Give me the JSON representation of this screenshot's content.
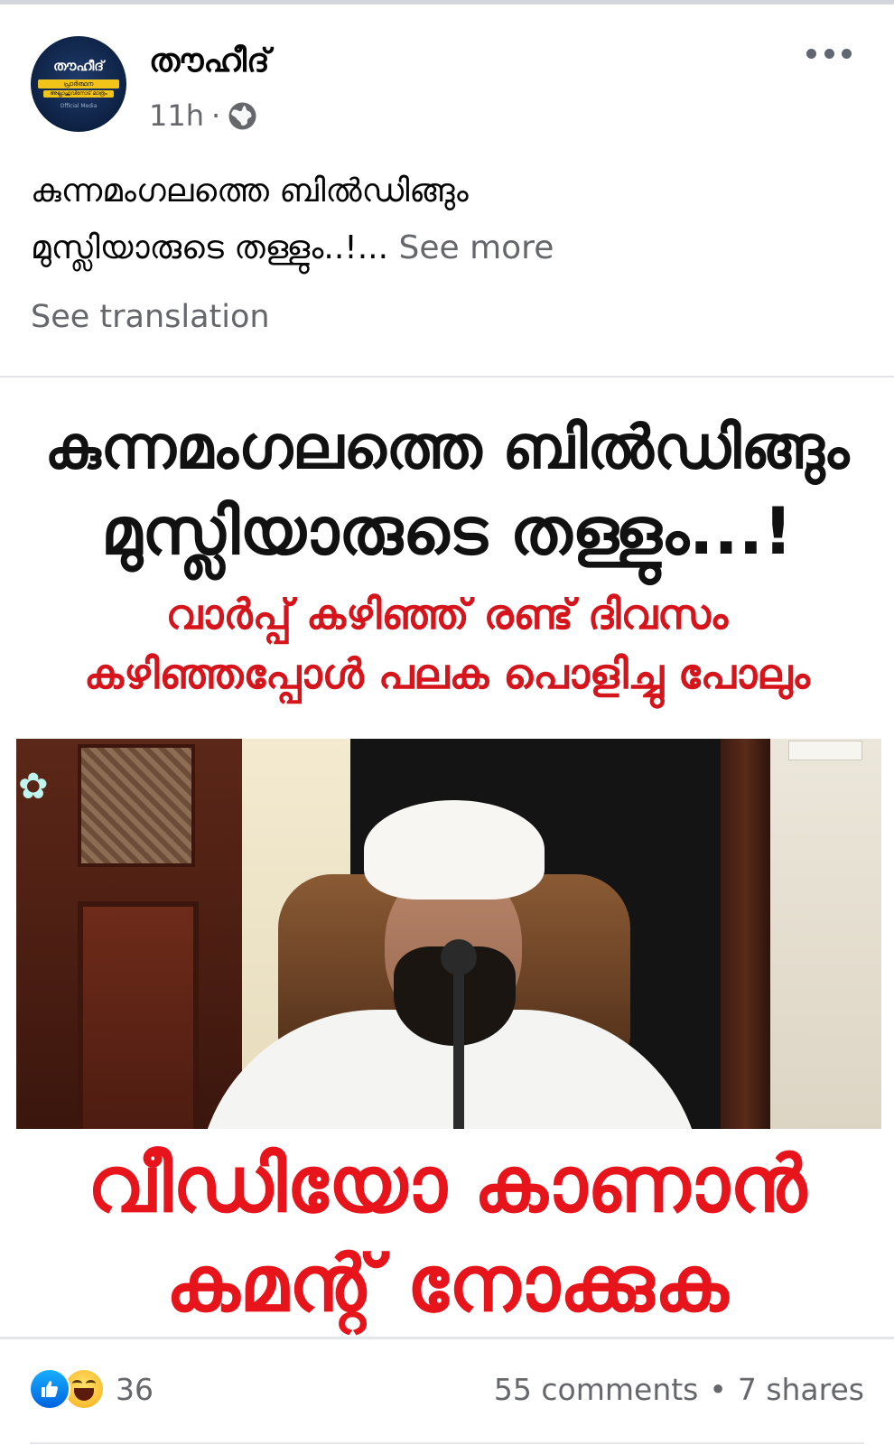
{
  "post": {
    "page_name": "തൗഹീദ്",
    "time": "11h",
    "separator": "·",
    "privacy_icon": "globe-icon",
    "text_line1": "കുന്നമംഗലത്തെ ബിൽഡിങ്ങും",
    "text_line2": "മുസ്ലിയാരുടെ തള്ളും..!...",
    "see_more": "See more",
    "see_translation": "See translation"
  },
  "avatar": {
    "title": "തൗഹീദ്",
    "band_line1": "പ്രാർത്ഥന",
    "band_line2": "അല്ലാഹുവിനോട് മാത്രം",
    "footer": "Official Media"
  },
  "image": {
    "headline_line1": "കുന്നമംഗലത്തെ ബിൽഡിങ്ങും",
    "headline_line2": "മുസ്ലിയാരുടെ തള്ളും...!",
    "subhead_line1": "വാർപ്പ് കഴിഞ്ഞ് രണ്ട് ദിവസം",
    "subhead_line2": "കഴിഞ്ഞപ്പോൾ പലക പൊളിച്ചു പോലും",
    "cta_line1": "വീഡിയോ കാണാൻ",
    "cta_line2": "കമന്റ് നോക്കുക"
  },
  "footer": {
    "reaction_icons": [
      "like-icon",
      "haha-icon"
    ],
    "reaction_count": "36",
    "comments": "55 comments",
    "bullet": "•",
    "shares": "7 shares"
  },
  "colors": {
    "headline_red": "#d6141b",
    "cta_red": "#e8141c",
    "muted_text": "#65676b",
    "like_blue": "#0062df"
  }
}
